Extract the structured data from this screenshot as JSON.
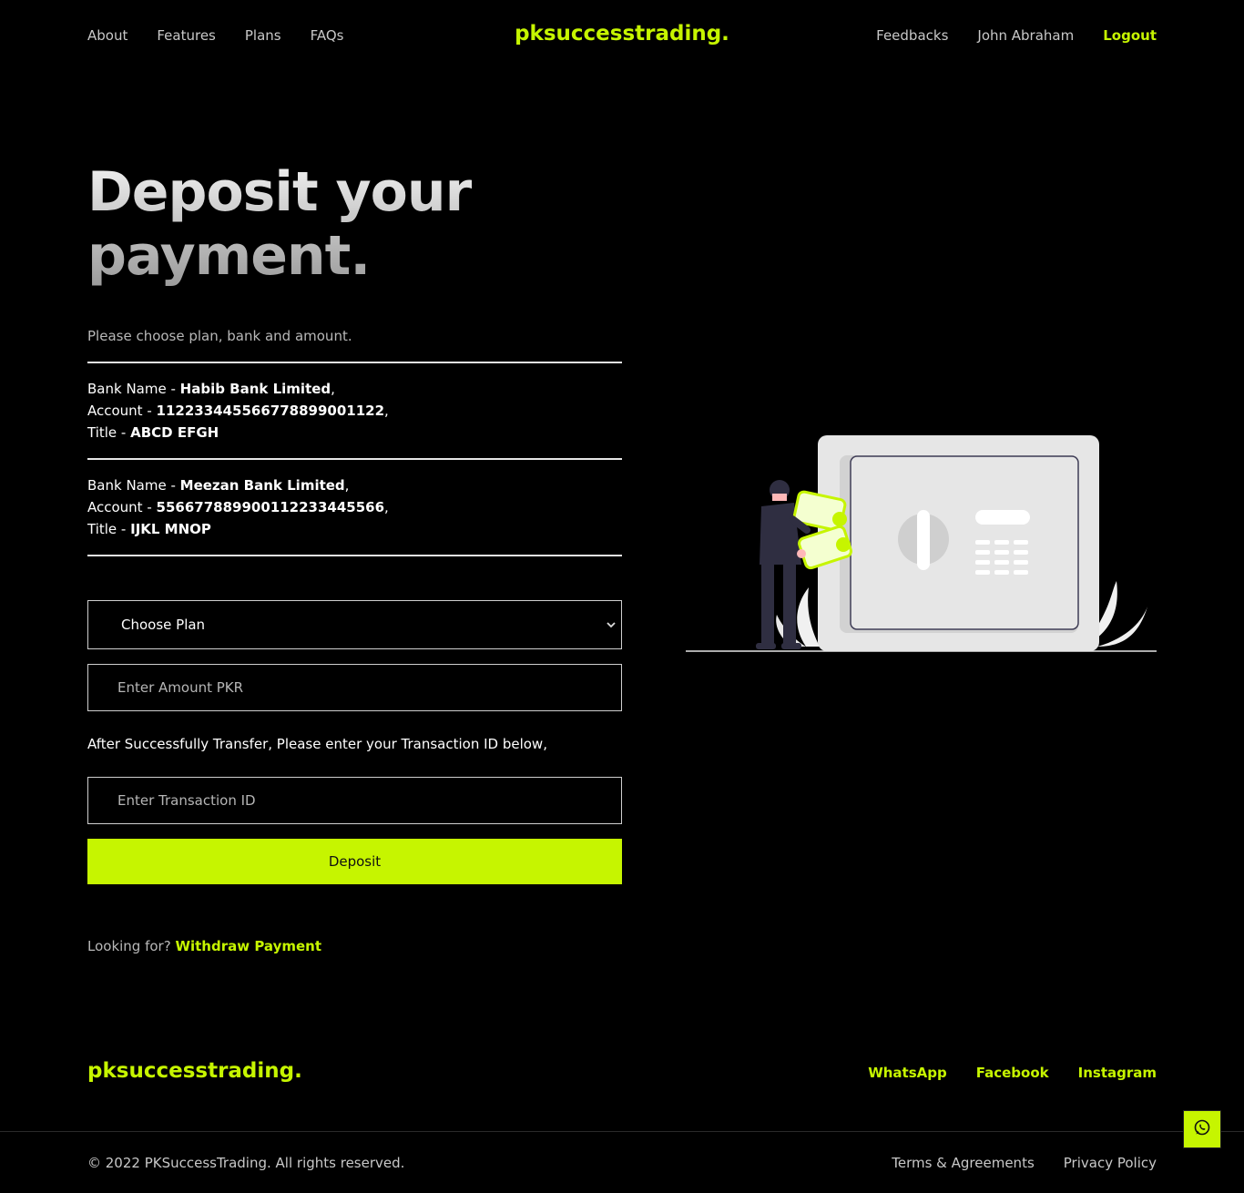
{
  "nav": {
    "left": [
      "About",
      "Features",
      "Plans",
      "FAQs"
    ],
    "brand": "pksuccesstrading.",
    "feedbacks": "Feedbacks",
    "user": "John Abraham",
    "logout": "Logout"
  },
  "hero": {
    "title": "Deposit your payment.",
    "subtitle": "Please choose plan, bank and amount."
  },
  "banks": [
    {
      "name_label": "Bank Name - ",
      "name": "Habib Bank Limited",
      "account_label": "Account - ",
      "account": "11223344556677889900112­2",
      "title_label": "Title - ",
      "title": "ABCD EFGH"
    },
    {
      "name_label": "Bank Name - ",
      "name": "Meezan Bank Limited",
      "account_label": "Account - ",
      "account": "556677889900112233445566",
      "title_label": "Title - ",
      "title": "IJKL MNOP"
    }
  ],
  "form": {
    "plan_selected": "Choose Plan",
    "amount_placeholder": "Enter Amount PKR",
    "transfer_note": "After Successfully Transfer, Please enter your Transaction ID below,",
    "txn_placeholder": "Enter Transaction ID",
    "submit_label": "Deposit"
  },
  "lookfor": {
    "prefix": "Looking for? ",
    "link": "Withdraw Payment"
  },
  "footer": {
    "brand": "pksuccesstrading.",
    "social": [
      "WhatsApp",
      "Facebook",
      "Instagram"
    ],
    "copyright": "© 2022 PKSuccessTrading. All rights reserved.",
    "legal": [
      "Terms & Agreements",
      "Privacy Policy"
    ]
  },
  "colors": {
    "accent": "#c6f500",
    "background": "#000000"
  },
  "icons": {
    "floating_button": "whatsapp-icon",
    "select": "chevron-down-icon"
  }
}
